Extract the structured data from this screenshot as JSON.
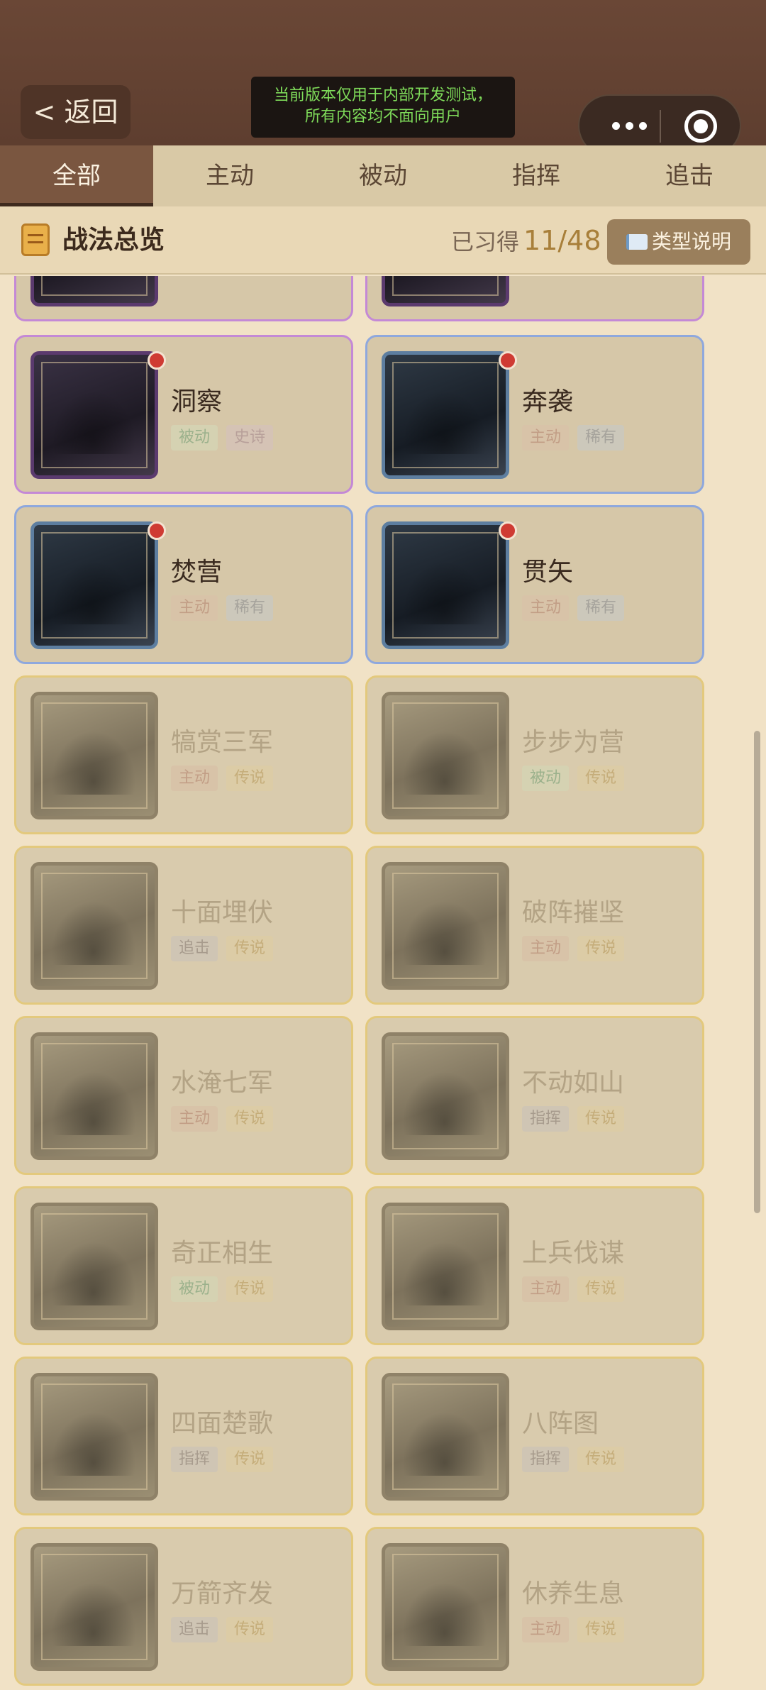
{
  "header": {
    "back_label": "< 返回",
    "notice_line1": "当前版本仅用于内部开发测试，",
    "notice_line2": "所有内容均不面向用户"
  },
  "tabs": [
    {
      "label": "全部",
      "active": true
    },
    {
      "label": "主动",
      "active": false
    },
    {
      "label": "被动",
      "active": false
    },
    {
      "label": "指挥",
      "active": false
    },
    {
      "label": "追击",
      "active": false
    }
  ],
  "summary": {
    "title": "战法总览",
    "learned_label": "已习得",
    "learned_count": "11/48",
    "type_button": "类型说明"
  },
  "cards": [
    {
      "name": "洞察",
      "type": "被动",
      "rarity": "史诗",
      "quality": "epic",
      "locked": false,
      "new": true
    },
    {
      "name": "奔袭",
      "type": "主动",
      "rarity": "稀有",
      "quality": "rare",
      "locked": false,
      "new": true
    },
    {
      "name": "焚营",
      "type": "主动",
      "rarity": "稀有",
      "quality": "rare",
      "locked": false,
      "new": true
    },
    {
      "name": "贯矢",
      "type": "主动",
      "rarity": "稀有",
      "quality": "rare",
      "locked": false,
      "new": true
    },
    {
      "name": "犒赏三军",
      "type": "主动",
      "rarity": "传说",
      "quality": "legend",
      "locked": true,
      "new": false
    },
    {
      "name": "步步为营",
      "type": "被动",
      "rarity": "传说",
      "quality": "legend",
      "locked": true,
      "new": false
    },
    {
      "name": "十面埋伏",
      "type": "追击",
      "rarity": "传说",
      "quality": "legend",
      "locked": true,
      "new": false
    },
    {
      "name": "破阵摧坚",
      "type": "主动",
      "rarity": "传说",
      "quality": "legend",
      "locked": true,
      "new": false
    },
    {
      "name": "水淹七军",
      "type": "主动",
      "rarity": "传说",
      "quality": "legend",
      "locked": true,
      "new": false
    },
    {
      "name": "不动如山",
      "type": "指挥",
      "rarity": "传说",
      "quality": "legend",
      "locked": true,
      "new": false
    },
    {
      "name": "奇正相生",
      "type": "被动",
      "rarity": "传说",
      "quality": "legend",
      "locked": true,
      "new": false
    },
    {
      "name": "上兵伐谋",
      "type": "主动",
      "rarity": "传说",
      "quality": "legend",
      "locked": true,
      "new": false
    },
    {
      "name": "四面楚歌",
      "type": "指挥",
      "rarity": "传说",
      "quality": "legend",
      "locked": true,
      "new": false
    },
    {
      "name": "八阵图",
      "type": "指挥",
      "rarity": "传说",
      "quality": "legend",
      "locked": true,
      "new": false
    },
    {
      "name": "万箭齐发",
      "type": "追击",
      "rarity": "传说",
      "quality": "legend",
      "locked": true,
      "new": false
    },
    {
      "name": "休养生息",
      "type": "主动",
      "rarity": "传说",
      "quality": "legend",
      "locked": true,
      "new": false
    }
  ]
}
